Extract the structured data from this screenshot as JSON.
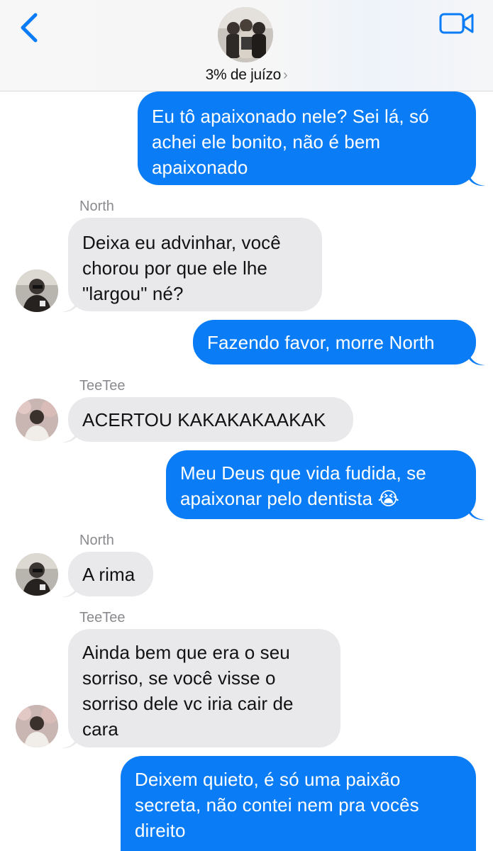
{
  "header": {
    "title": "3% de juízo",
    "chevron": "›",
    "back_icon": "chevron-left-icon",
    "video_icon": "video-camera-icon"
  },
  "colors": {
    "outgoing_bubble": "#0a7cf6",
    "incoming_bubble": "#e9e9eb",
    "accent": "#0a7cf6"
  },
  "messages": [
    {
      "direction": "out",
      "lines": [
        "Eu tô apaixonado nele? Sei lá, só",
        "achei ele bonito, não é bem",
        "apaixonado"
      ]
    },
    {
      "direction": "in",
      "sender": "North",
      "lines": [
        "Deixa eu advinhar, você",
        "chorou por que ele lhe",
        "\"largou\" né?"
      ]
    },
    {
      "direction": "out",
      "lines": [
        "Fazendo favor, morre North"
      ]
    },
    {
      "direction": "in",
      "sender": "TeeTee",
      "lines": [
        "ACERTOU KAKAKAKAAKAK"
      ]
    },
    {
      "direction": "out",
      "lines": [
        "Meu Deus que vida fudida, se",
        "apaixonar pelo dentista 😭"
      ]
    },
    {
      "direction": "in",
      "sender": "North",
      "lines": [
        "A rima"
      ]
    },
    {
      "direction": "in",
      "sender": "TeeTee",
      "lines": [
        "Ainda bem que era o seu",
        "sorriso, se você visse o",
        "sorriso dele vc iria cair de",
        "cara"
      ]
    },
    {
      "direction": "out",
      "lines": [
        "Deixem quieto, é só uma paixão",
        "secreta, não contei nem pra vocês",
        "direito"
      ]
    }
  ]
}
